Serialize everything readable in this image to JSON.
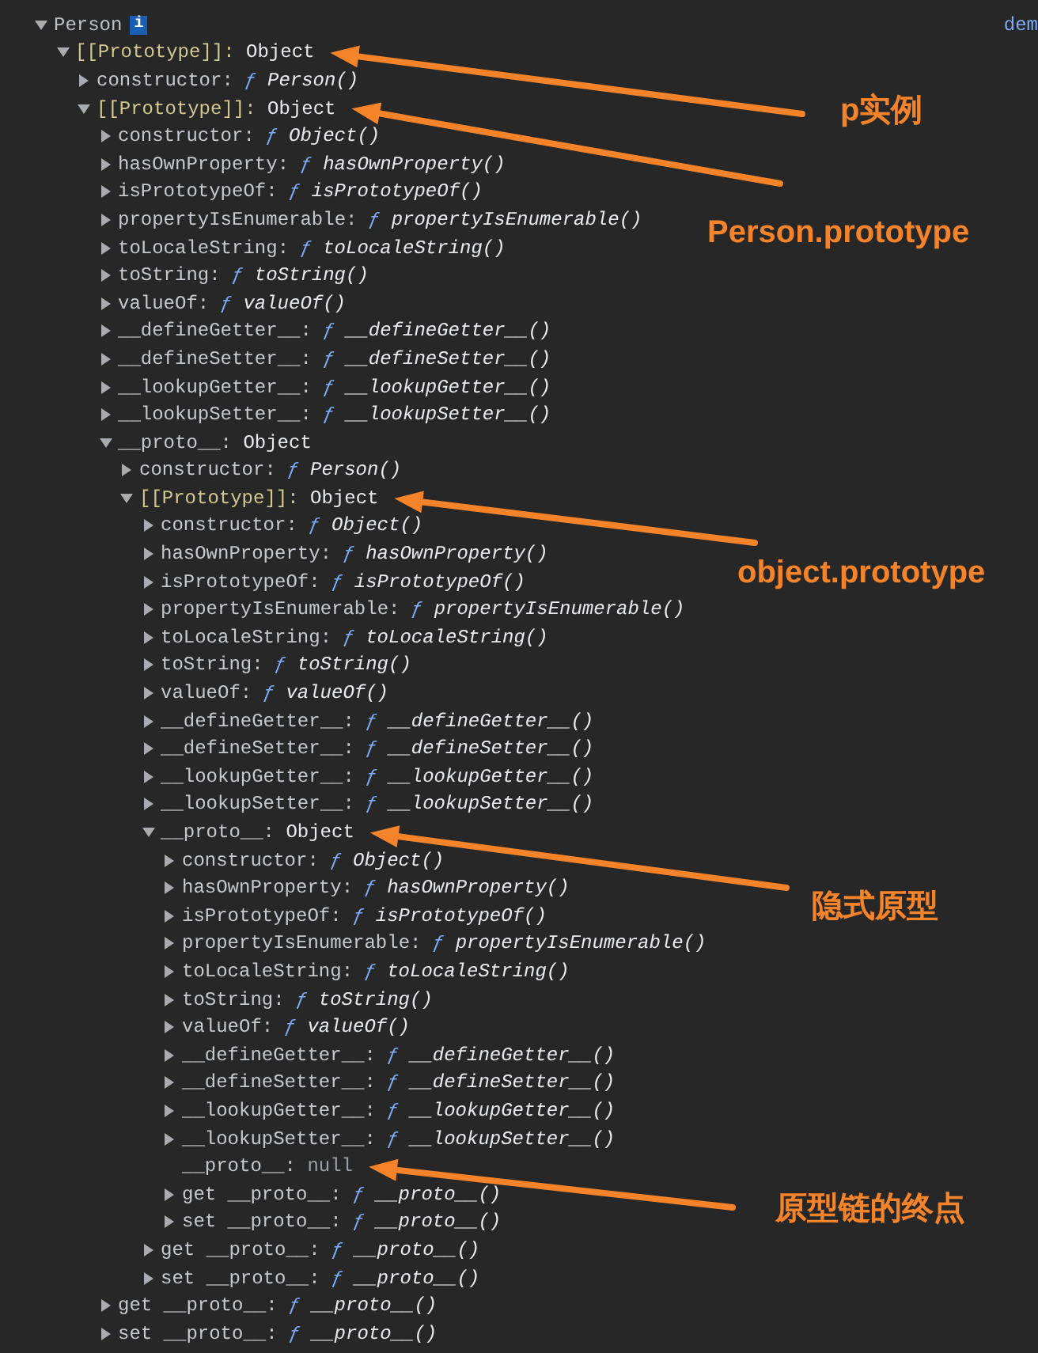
{
  "tree": [
    {
      "key": "Person",
      "kind": "root",
      "badge": "i",
      "link": "dem",
      "expanded": true,
      "children": [
        {
          "key": "[[Prototype]]:",
          "kind": "internal",
          "value": "Object",
          "expanded": true,
          "annotation": "p实例",
          "children": [
            {
              "key": "constructor:",
              "kind": "method",
              "prefix": "ƒ",
              "value": "Person()",
              "expanded": false
            },
            {
              "key": "[[Prototype]]:",
              "kind": "internal",
              "value": "Object",
              "expanded": true,
              "annotation": "Person.prototype",
              "children": [
                {
                  "key": "constructor:",
                  "kind": "method",
                  "prefix": "ƒ",
                  "value": "Object()",
                  "expanded": false
                },
                {
                  "key": "hasOwnProperty:",
                  "kind": "method",
                  "prefix": "ƒ",
                  "value": "hasOwnProperty()",
                  "expanded": false
                },
                {
                  "key": "isPrototypeOf:",
                  "kind": "method",
                  "prefix": "ƒ",
                  "value": "isPrototypeOf()",
                  "expanded": false
                },
                {
                  "key": "propertyIsEnumerable:",
                  "kind": "method",
                  "prefix": "ƒ",
                  "value": "propertyIsEnumerable()",
                  "expanded": false
                },
                {
                  "key": "toLocaleString:",
                  "kind": "method",
                  "prefix": "ƒ",
                  "value": "toLocaleString()",
                  "expanded": false
                },
                {
                  "key": "toString:",
                  "kind": "method",
                  "prefix": "ƒ",
                  "value": "toString()",
                  "expanded": false
                },
                {
                  "key": "valueOf:",
                  "kind": "method",
                  "prefix": "ƒ",
                  "value": "valueOf()",
                  "expanded": false
                },
                {
                  "key": "__defineGetter__:",
                  "kind": "method",
                  "prefix": "ƒ",
                  "value": "__defineGetter__()",
                  "expanded": false
                },
                {
                  "key": "__defineSetter__:",
                  "kind": "method",
                  "prefix": "ƒ",
                  "value": "__defineSetter__()",
                  "expanded": false
                },
                {
                  "key": "__lookupGetter__:",
                  "kind": "method",
                  "prefix": "ƒ",
                  "value": "__lookupGetter__()",
                  "expanded": false
                },
                {
                  "key": "__lookupSetter__:",
                  "kind": "method",
                  "prefix": "ƒ",
                  "value": "__lookupSetter__()",
                  "expanded": false
                },
                {
                  "key": "__proto__:",
                  "kind": "property",
                  "value": "Object",
                  "expanded": true,
                  "children": [
                    {
                      "key": "constructor:",
                      "kind": "method",
                      "prefix": "ƒ",
                      "value": "Person()",
                      "expanded": false
                    },
                    {
                      "key": "[[Prototype]]:",
                      "kind": "internal",
                      "value": "Object",
                      "expanded": true,
                      "annotation": "object.prototype",
                      "children": [
                        {
                          "key": "constructor:",
                          "kind": "method",
                          "prefix": "ƒ",
                          "value": "Object()",
                          "expanded": false
                        },
                        {
                          "key": "hasOwnProperty:",
                          "kind": "method",
                          "prefix": "ƒ",
                          "value": "hasOwnProperty()",
                          "expanded": false
                        },
                        {
                          "key": "isPrototypeOf:",
                          "kind": "method",
                          "prefix": "ƒ",
                          "value": "isPrototypeOf()",
                          "expanded": false
                        },
                        {
                          "key": "propertyIsEnumerable:",
                          "kind": "method",
                          "prefix": "ƒ",
                          "value": "propertyIsEnumerable()",
                          "expanded": false
                        },
                        {
                          "key": "toLocaleString:",
                          "kind": "method",
                          "prefix": "ƒ",
                          "value": "toLocaleString()",
                          "expanded": false
                        },
                        {
                          "key": "toString:",
                          "kind": "method",
                          "prefix": "ƒ",
                          "value": "toString()",
                          "expanded": false
                        },
                        {
                          "key": "valueOf:",
                          "kind": "method",
                          "prefix": "ƒ",
                          "value": "valueOf()",
                          "expanded": false
                        },
                        {
                          "key": "__defineGetter__:",
                          "kind": "method",
                          "prefix": "ƒ",
                          "value": "__defineGetter__()",
                          "expanded": false
                        },
                        {
                          "key": "__defineSetter__:",
                          "kind": "method",
                          "prefix": "ƒ",
                          "value": "__defineSetter__()",
                          "expanded": false
                        },
                        {
                          "key": "__lookupGetter__:",
                          "kind": "method",
                          "prefix": "ƒ",
                          "value": "__lookupGetter__()",
                          "expanded": false
                        },
                        {
                          "key": "__lookupSetter__:",
                          "kind": "method",
                          "prefix": "ƒ",
                          "value": "__lookupSetter__()",
                          "expanded": false
                        },
                        {
                          "key": "__proto__:",
                          "kind": "property",
                          "value": "Object",
                          "expanded": true,
                          "annotation": "隐式原型",
                          "children": [
                            {
                              "key": "constructor:",
                              "kind": "method",
                              "prefix": "ƒ",
                              "value": "Object()",
                              "expanded": false
                            },
                            {
                              "key": "hasOwnProperty:",
                              "kind": "method",
                              "prefix": "ƒ",
                              "value": "hasOwnProperty()",
                              "expanded": false
                            },
                            {
                              "key": "isPrototypeOf:",
                              "kind": "method",
                              "prefix": "ƒ",
                              "value": "isPrototypeOf()",
                              "expanded": false
                            },
                            {
                              "key": "propertyIsEnumerable:",
                              "kind": "method",
                              "prefix": "ƒ",
                              "value": "propertyIsEnumerable()",
                              "expanded": false
                            },
                            {
                              "key": "toLocaleString:",
                              "kind": "method",
                              "prefix": "ƒ",
                              "value": "toLocaleString()",
                              "expanded": false
                            },
                            {
                              "key": "toString:",
                              "kind": "method",
                              "prefix": "ƒ",
                              "value": "toString()",
                              "expanded": false
                            },
                            {
                              "key": "valueOf:",
                              "kind": "method",
                              "prefix": "ƒ",
                              "value": "valueOf()",
                              "expanded": false
                            },
                            {
                              "key": "__defineGetter__:",
                              "kind": "method",
                              "prefix": "ƒ",
                              "value": "__defineGetter__()",
                              "expanded": false
                            },
                            {
                              "key": "__defineSetter__:",
                              "kind": "method",
                              "prefix": "ƒ",
                              "value": "__defineSetter__()",
                              "expanded": false
                            },
                            {
                              "key": "__lookupGetter__:",
                              "kind": "method",
                              "prefix": "ƒ",
                              "value": "__lookupGetter__()",
                              "expanded": false
                            },
                            {
                              "key": "__lookupSetter__:",
                              "kind": "method",
                              "prefix": "ƒ",
                              "value": "__lookupSetter__()",
                              "expanded": false
                            },
                            {
                              "key": "__proto__:",
                              "kind": "null",
                              "value": "null",
                              "annotation": "原型链的终点"
                            },
                            {
                              "key": "get __proto__:",
                              "kind": "method",
                              "prefix": "ƒ",
                              "value": "__proto__()",
                              "expanded": false
                            },
                            {
                              "key": "set __proto__:",
                              "kind": "method",
                              "prefix": "ƒ",
                              "value": "__proto__()",
                              "expanded": false
                            }
                          ]
                        },
                        {
                          "key": "get __proto__:",
                          "kind": "method",
                          "prefix": "ƒ",
                          "value": "__proto__()",
                          "expanded": false
                        },
                        {
                          "key": "set __proto__:",
                          "kind": "method",
                          "prefix": "ƒ",
                          "value": "__proto__()",
                          "expanded": false
                        }
                      ]
                    }
                  ]
                },
                {
                  "key": "get __proto__:",
                  "kind": "method",
                  "prefix": "ƒ",
                  "value": "__proto__()",
                  "expanded": false
                },
                {
                  "key": "set __proto__:",
                  "kind": "method",
                  "prefix": "ƒ",
                  "value": "__proto__()",
                  "expanded": false
                }
              ]
            }
          ]
        }
      ]
    }
  ]
}
